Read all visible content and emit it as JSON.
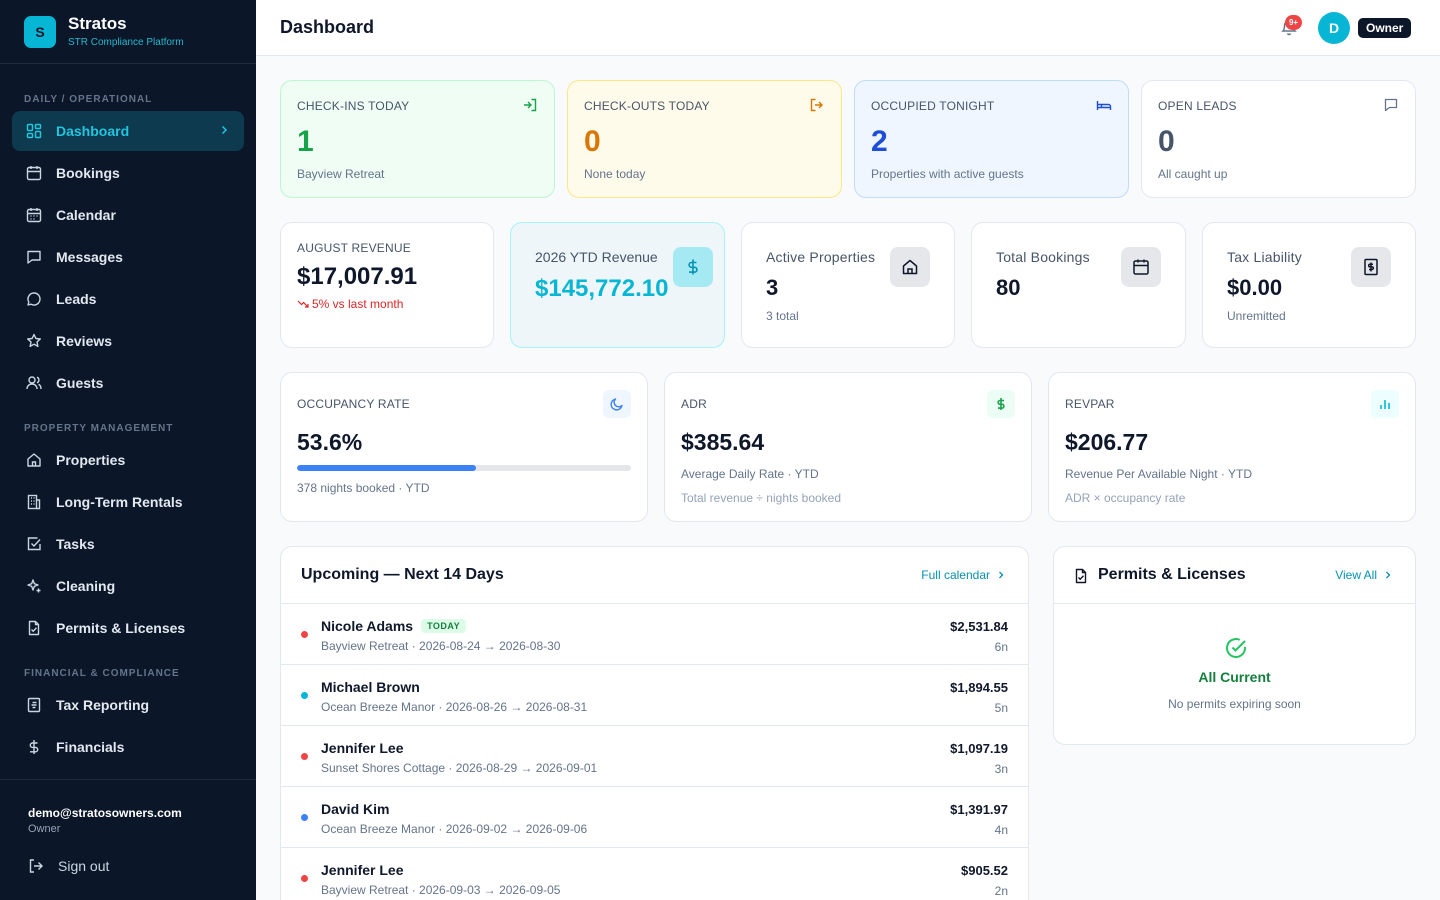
{
  "brand": {
    "logo_letter": "S",
    "name": "Stratos",
    "subtitle": "STR Compliance Platform"
  },
  "sidebar": {
    "sections": [
      {
        "label": "DAILY / OPERATIONAL"
      },
      {
        "label": "PROPERTY MANAGEMENT"
      },
      {
        "label": "FINANCIAL & COMPLIANCE"
      }
    ],
    "items": [
      {
        "label": "Dashboard",
        "icon": "grid-icon",
        "active": true
      },
      {
        "label": "Bookings",
        "icon": "calendar-icon"
      },
      {
        "label": "Calendar",
        "icon": "calendar-days-icon"
      },
      {
        "label": "Messages",
        "icon": "message-square-icon"
      },
      {
        "label": "Leads",
        "icon": "message-circle-icon"
      },
      {
        "label": "Reviews",
        "icon": "star-icon"
      },
      {
        "label": "Guests",
        "icon": "users-icon"
      },
      {
        "label": "Properties",
        "icon": "home-icon"
      },
      {
        "label": "Long-Term Rentals",
        "icon": "building-icon"
      },
      {
        "label": "Tasks",
        "icon": "checkbox-icon"
      },
      {
        "label": "Cleaning",
        "icon": "sparkles-icon"
      },
      {
        "label": "Permits & Licenses",
        "icon": "file-check-icon"
      },
      {
        "label": "Tax Reporting",
        "icon": "receipt-icon"
      },
      {
        "label": "Financials",
        "icon": "dollar-icon"
      }
    ],
    "user": {
      "email": "demo@stratosowners.com",
      "role": "Owner"
    },
    "signout_label": "Sign out"
  },
  "header": {
    "title": "Dashboard",
    "notification_badge": "9+",
    "avatar_letter": "D",
    "role": "Owner"
  },
  "kpis": [
    {
      "label": "CHECK-INS TODAY",
      "value": "1",
      "sub": "Bayview Retreat",
      "icon": "log-in-icon",
      "accent": "#16a34a",
      "bg": "#f0fdf4",
      "border": "#bbf7d0"
    },
    {
      "label": "CHECK-OUTS TODAY",
      "value": "0",
      "sub": "None today",
      "icon": "log-out-icon",
      "accent": "#d97706",
      "bg": "#fffbeb",
      "border": "#fde68a"
    },
    {
      "label": "OCCUPIED TONIGHT",
      "value": "2",
      "sub": "Properties with active guests",
      "icon": "bed-icon",
      "accent": "#1d4ed8",
      "bg": "#eff6ff",
      "border": "#bfdbfe"
    },
    {
      "label": "OPEN LEADS",
      "value": "0",
      "sub": "All caught up",
      "icon": "message-square-icon",
      "accent": "#475569",
      "bg": "#ffffff",
      "border": "#e2e8f0"
    }
  ],
  "stats": {
    "revenue": {
      "label": "AUGUST REVENUE",
      "value": "$17,007.91",
      "trend": "5% vs last month"
    },
    "ytd": {
      "label": "2026 YTD Revenue",
      "value": "$145,772.10"
    },
    "properties": {
      "label": "Active Properties",
      "value": "3",
      "sub": "3 total"
    },
    "bookings": {
      "label": "Total Bookings",
      "value": "80"
    },
    "tax": {
      "label": "Tax Liability",
      "value": "$0.00",
      "sub": "Unremitted"
    }
  },
  "metrics": {
    "occupancy": {
      "label": "OCCUPANCY RATE",
      "value": "53.6%",
      "progress_pct": 53.6,
      "sub": "378 nights booked · YTD"
    },
    "adr": {
      "label": "ADR",
      "value": "$385.64",
      "sub": "Average Daily Rate · YTD",
      "sub2": "Total revenue ÷ nights booked"
    },
    "revpar": {
      "label": "REVPAR",
      "value": "$206.77",
      "sub": "Revenue Per Available Night · YTD",
      "sub2": "ADR × occupancy rate"
    }
  },
  "upcoming": {
    "title": "Upcoming — Next 14 Days",
    "link_label": "Full calendar",
    "today_tag": "TODAY",
    "rows": [
      {
        "name": "Nicole Adams",
        "detail": "Bayview Retreat · 2026-08-24 → 2026-08-30",
        "amount": "$2,531.84",
        "nights": "6n",
        "dot": "#ef4444",
        "today": true
      },
      {
        "name": "Michael Brown",
        "detail": "Ocean Breeze Manor · 2026-08-26 → 2026-08-31",
        "amount": "$1,894.55",
        "nights": "5n",
        "dot": "#06b6d4"
      },
      {
        "name": "Jennifer Lee",
        "detail": "Sunset Shores Cottage · 2026-08-29 → 2026-09-01",
        "amount": "$1,097.19",
        "nights": "3n",
        "dot": "#ef4444"
      },
      {
        "name": "David Kim",
        "detail": "Ocean Breeze Manor · 2026-09-02 → 2026-09-06",
        "amount": "$1,391.97",
        "nights": "4n",
        "dot": "#3b82f6"
      },
      {
        "name": "Jennifer Lee",
        "detail": "Bayview Retreat · 2026-09-03 → 2026-09-05",
        "amount": "$905.52",
        "nights": "2n",
        "dot": "#ef4444"
      }
    ]
  },
  "permits": {
    "title": "Permits & Licenses",
    "link_label": "View All",
    "status_title": "All Current",
    "status_sub": "No permits expiring soon"
  }
}
